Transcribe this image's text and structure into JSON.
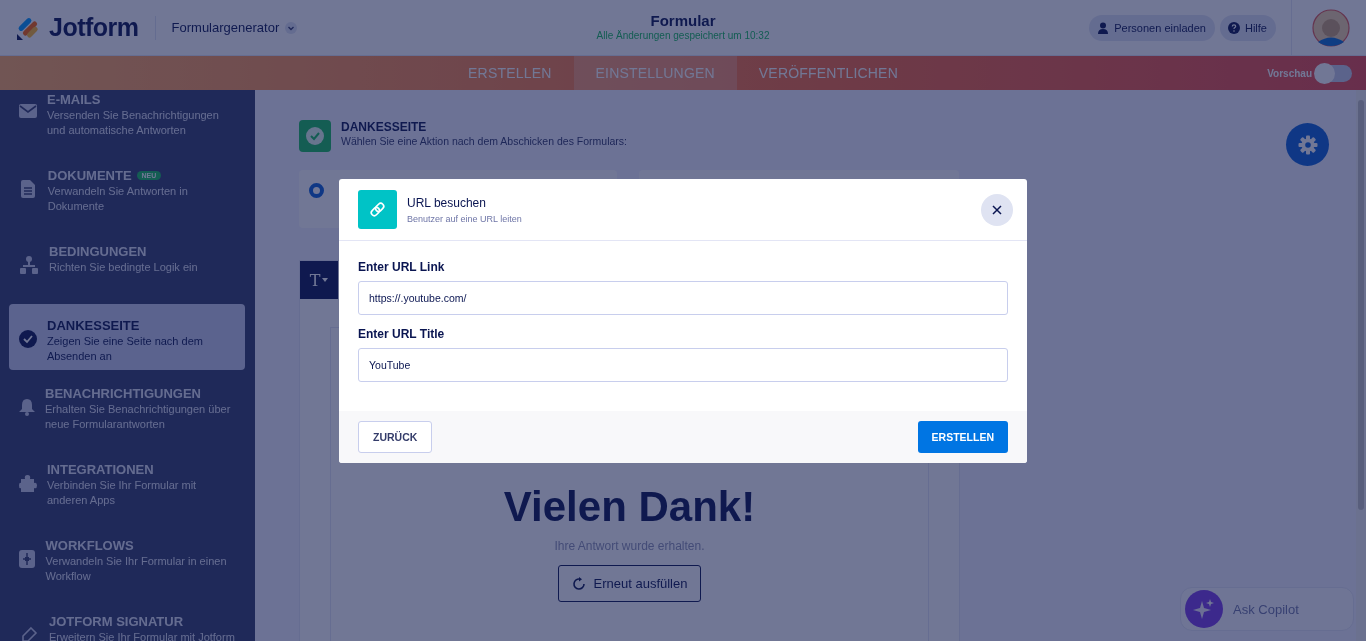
{
  "header": {
    "logo": "Jotform",
    "product": "Formulargenerator",
    "title": "Formular",
    "save_status": "Alle Änderungen gespeichert um 10:32",
    "buttons": [
      {
        "label": "Personen einladen",
        "kind": "invite"
      },
      {
        "label": "Hilfe",
        "kind": "help"
      }
    ]
  },
  "nav": {
    "tabs": [
      {
        "label": "ERSTELLEN",
        "selected": false
      },
      {
        "label": "EINSTELLUNGEN",
        "selected": true
      },
      {
        "label": "VERÖFFENTLICHEN",
        "selected": false
      }
    ],
    "preview": {
      "label": "Vorschau",
      "on": false
    }
  },
  "sidebar": {
    "items": [
      {
        "title": "E-MAILS",
        "description": "Versenden Sie Benachrichtigungen und automatische Antworten",
        "selected": false
      },
      {
        "title": "DOKUMENTE",
        "badge": "NEU",
        "description": "Verwandeln Sie Antworten in Dokumente",
        "selected": false
      },
      {
        "title": "BEDINGUNGEN",
        "description": "Richten Sie bedingte Logik ein",
        "selected": false
      },
      {
        "title": "DANKESSEITE",
        "description": "Zeigen Sie eine Seite nach dem Absenden an",
        "selected": true
      },
      {
        "title": "BENACHRICHTIGUNGEN",
        "description": "Erhalten Sie Benachrichtigungen über neue Formularantworten",
        "selected": false
      },
      {
        "title": "INTEGRATIONEN",
        "description": "Verbinden Sie Ihr Formular mit anderen Apps",
        "selected": false
      },
      {
        "title": "WORKFLOWS",
        "description": "Verwandeln Sie Ihr Formular in einen Workflow",
        "selected": false
      },
      {
        "title": "JOTFORM SIGNATUR",
        "description": "Erweitern Sie Ihr Formular mit Jotform",
        "selected": false
      }
    ]
  },
  "page": {
    "title": "DANKESSEITE",
    "subtitle": "Wählen Sie eine Aktion nach dem Abschicken des Formulars:",
    "option_selected": true,
    "toolbar_format": "T"
  },
  "preview": {
    "heading": "Vielen Dank!",
    "message": "Ihre Antwort wurde erhalten.",
    "button": "Erneut ausfüllen"
  },
  "copilot": {
    "label": "Ask Copilot"
  },
  "modal": {
    "title": "URL besuchen",
    "subtitle": "Benutzer auf eine URL leiten",
    "fields": [
      {
        "label": "Enter URL Link",
        "value": "https://.youtube.com/"
      },
      {
        "label": "Enter URL Title",
        "value": "YouTube"
      }
    ],
    "back": "ZURÜCK",
    "submit": "ERSTELLEN"
  }
}
